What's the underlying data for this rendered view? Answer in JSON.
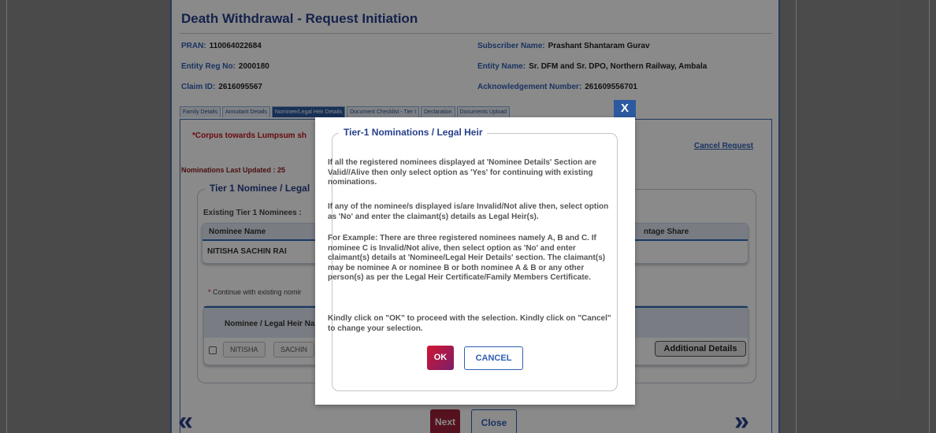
{
  "page": {
    "title": "Death Withdrawal - Request Initiation",
    "info": {
      "pran_label": "PRAN:",
      "pran_value": "110064022684",
      "subscriber_label": "Subscriber Name:",
      "subscriber_value": "Prashant Shantaram Gurav",
      "entity_reg_label": "Entity Reg No:",
      "entity_reg_value": "2000180",
      "entity_name_label": "Entity Name:",
      "entity_name_value": "Sr. DFM and Sr. DPO, Northern Railway, Ambala",
      "claim_label": "Claim ID:",
      "claim_value": "2616095567",
      "ack_label": "Acknowledgement Number:",
      "ack_value": "261609556701"
    },
    "tabs": [
      "Family Details",
      "Annuitant Details",
      "Nominee/Legal Heir Details",
      "Document Checklist - Tier I",
      "Declaration",
      "Documents Upload"
    ],
    "corpus_text": "*Corpus towards Lumpsum sh",
    "cancel_request": "Cancel Request",
    "nominations_updated": "Nominations Last Updated : 25",
    "tier1_legend": "Tier 1 Nominee / Legal",
    "existing_label": "Existing Tier 1 Nominees :",
    "table1": {
      "col_name": "Nominee Name",
      "col_share": "ntage Share",
      "row_name": "NITISHA  SACHIN  RAI"
    },
    "continue_star": "*",
    "continue_label": "Continue with existing nomir",
    "table2": {
      "col_name": "Nominee / Legal Heir Na",
      "cell_first": "NITISHA",
      "cell_middle": "SACHIN",
      "additional_details": "Additional Details"
    },
    "nav": {
      "prev": "«",
      "next_arrow": "»",
      "next": "Next",
      "close": "Close"
    }
  },
  "modal": {
    "close_x": "X",
    "legend": "Tier-1 Nominations / Legal Heir",
    "para1": "If all the registered nominees displayed at 'Nominee Details' Section are Valid//Alive then only select option as 'Yes' for continuing with existing nominations.",
    "para2": "If any of the nominee/s displayed is/are Invalid/Not alive then, select option as 'No' and enter the claimant(s) details as Legal Heir(s).",
    "para3": "For Example: There are three registered nominees namely A, B and C. If nominee C is Invalid/Not alive, then select option as 'No' and enter claimant(s) details at 'Nominee/Legal Heir Details' section. The claimant(s) may be nominee A or nominee B or both nominee A & B or any other person(s) as per the Legal Heir Certificate/Family Members Certificate.",
    "para4": "Kindly click on \"OK\" to proceed with the selection. Kindly click on \"Cancel\" to change your selection.",
    "ok": "OK",
    "cancel": "CANCEL"
  }
}
